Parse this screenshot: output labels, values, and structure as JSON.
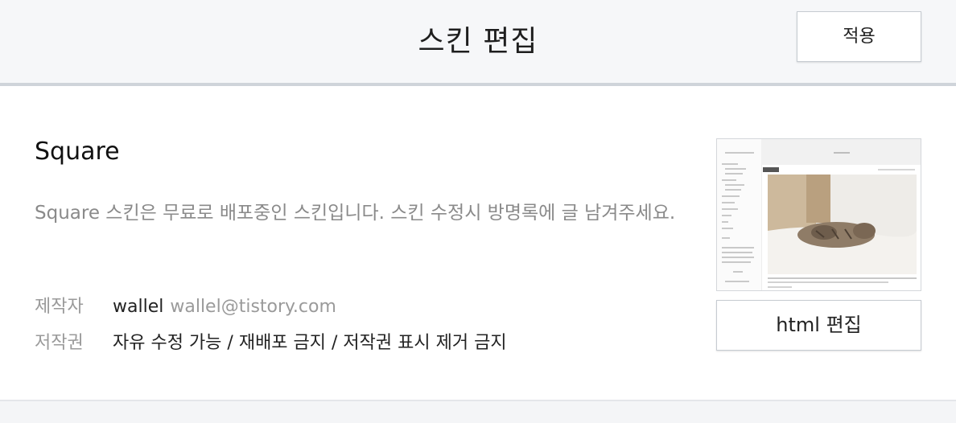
{
  "header": {
    "title": "스킨 편집",
    "apply_label": "적용"
  },
  "skin": {
    "name": "Square",
    "description": "Square 스킨은 무료로 배포중인 스킨입니다. 스킨 수정시 방명록에 글 남겨주세요.",
    "author_label": "제작자",
    "author_name": "wallel",
    "author_email": "wallel@tistory.com",
    "copyright_label": "저작권",
    "copyright_value": "자유 수정 가능 / 재배포 금지 / 저작권 표시 제거 금지"
  },
  "preview": {
    "html_edit_label": "html 편집",
    "thumbnail_icon": "skin-preview-thumbnail"
  },
  "colors": {
    "header_bg": "#f6f7f9",
    "header_border": "#cfd4da",
    "muted_text": "#8a8a8a"
  }
}
